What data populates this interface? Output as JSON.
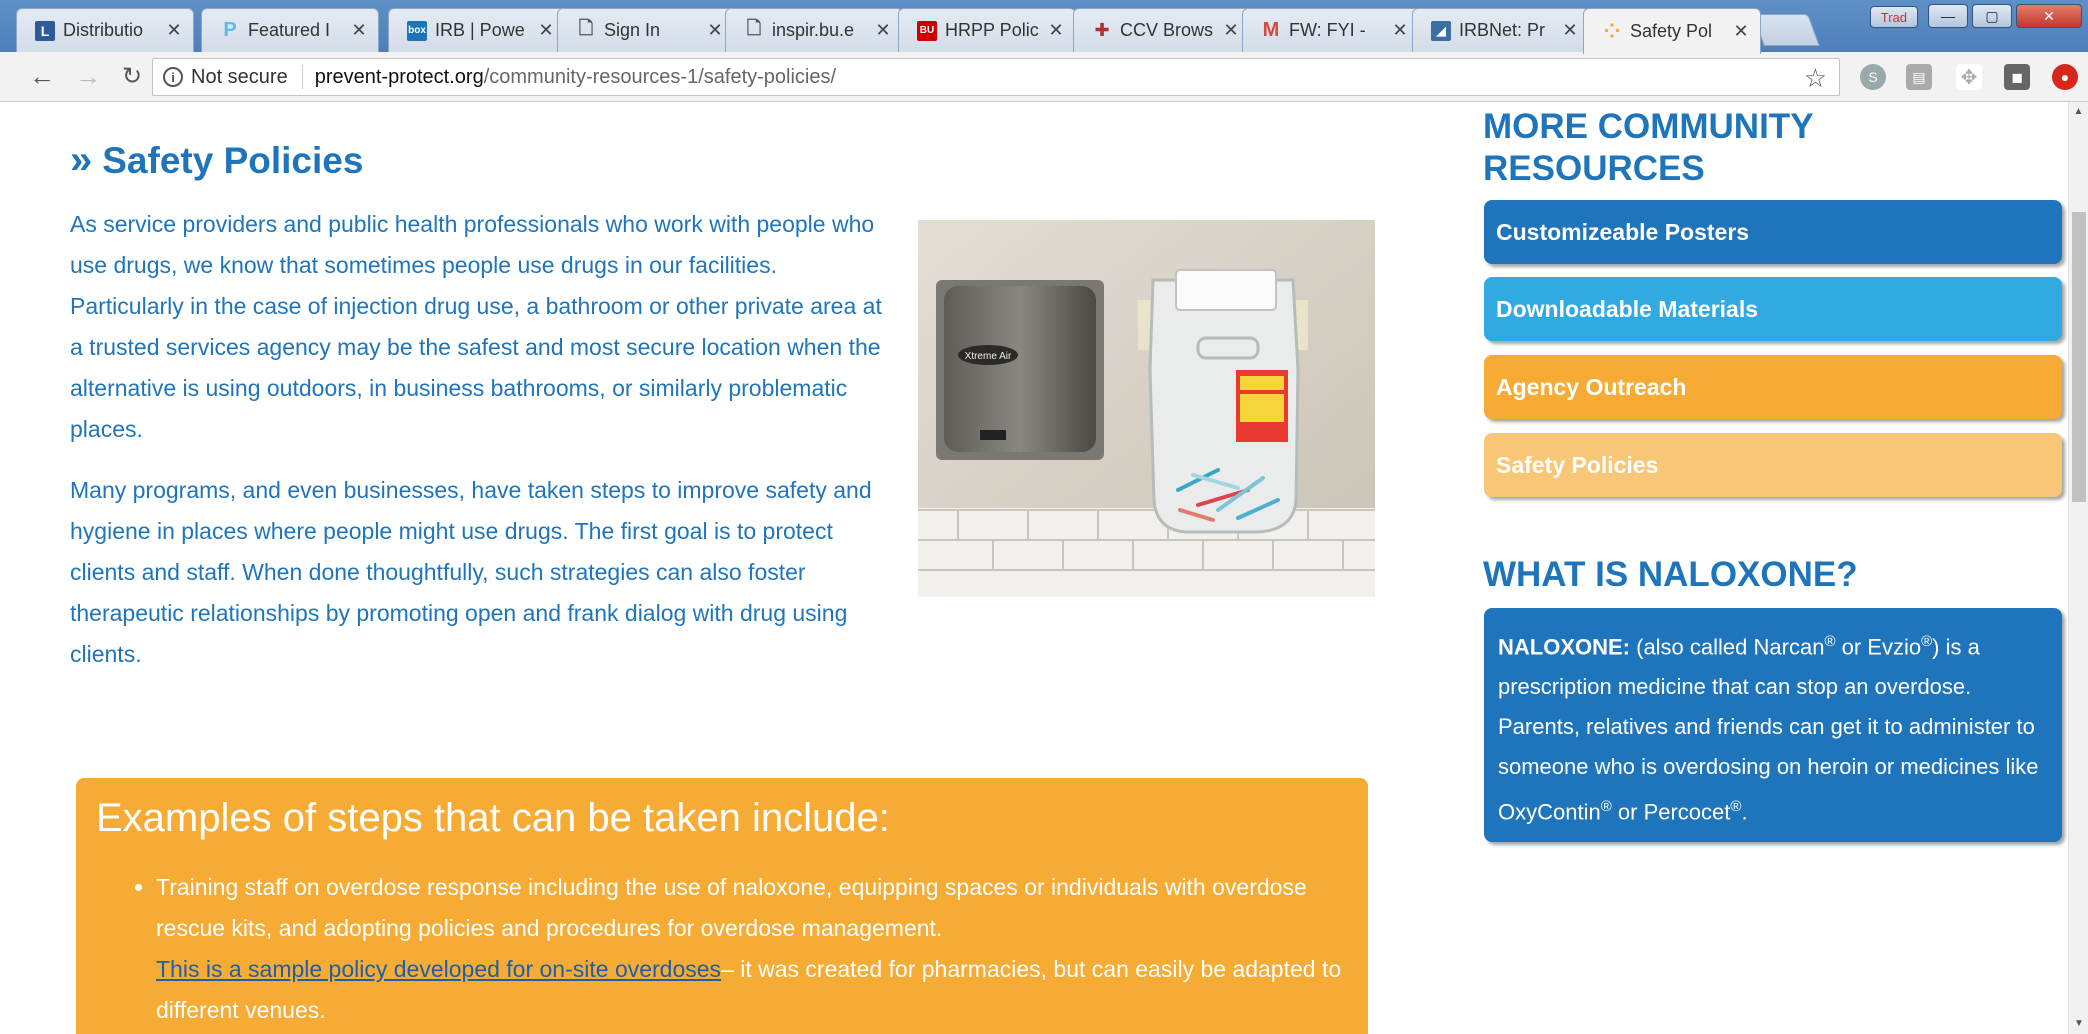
{
  "browser": {
    "tabs": [
      {
        "label": "Distributio",
        "favicon": "L",
        "favicon_color": "#2d5c99"
      },
      {
        "label": "Featured I",
        "favicon": "P",
        "favicon_color": "#5bbbe6"
      },
      {
        "label": "IRB | Powe",
        "favicon": "box",
        "favicon_color": "#1c75bc"
      },
      {
        "label": "Sign In",
        "favicon": "page-icon",
        "favicon_color": "#ffffff"
      },
      {
        "label": "inspir.bu.e",
        "favicon": "page-icon",
        "favicon_color": "#ffffff"
      },
      {
        "label": "HRPP Polic",
        "favicon": "BU",
        "favicon_color": "#cc0000"
      },
      {
        "label": "CCV Brows",
        "favicon": "+",
        "favicon_color": "#b03030"
      },
      {
        "label": "FW: FYI - ",
        "favicon": "M",
        "favicon_color": "#d64a3b"
      },
      {
        "label": "IRBNet: Pr",
        "favicon": "chart-icon",
        "favicon_color": "#3a6ea5"
      },
      {
        "label": "Safety Pol",
        "favicon": "dots-icon",
        "favicon_color": "#f6ab35"
      }
    ],
    "user_chip": "Trad",
    "security_label": "Not secure",
    "url_host": "prevent-protect.org",
    "url_path": "/community-resources-1/safety-policies/"
  },
  "page": {
    "title_marker": "»",
    "title": "Safety Policies",
    "para1": "As service providers and public health professionals who work with people who use drugs, we know that sometimes people use drugs in our facilities. Particularly in the case of injection drug use, a bathroom or other private area at a trusted services agency may be the safest and most secure location when the alternative is using outdoors, in business bathrooms, or similarly problematic places.",
    "para2": "Many programs, and even businesses, have taken steps to improve safety and hygiene in places where people might use drugs. The first goal is to protect clients and staff. When done thoughtfully, such strategies can also foster therapeutic relationships by promoting open and frank dialog with drug using clients.",
    "dryer_label": "Xtreme Air",
    "examples": {
      "heading": "Examples of steps that can be taken include:",
      "item1": "Training staff on overdose response including the use of naloxone, equipping spaces or individuals with overdose rescue kits, and adopting policies and procedures for overdose management.",
      "item1_link": "This is a sample policy developed for on-site overdoses",
      "item1_tail": "– it was created for pharmacies, but can easily be adapted to different venues."
    }
  },
  "sidebar": {
    "resources_heading": "MORE COMMUNITY RESOURCES",
    "buttons": [
      {
        "label": "Customizeable Posters",
        "color": "#1f75bb"
      },
      {
        "label": "Downloadable Materials",
        "color": "#31a9e1"
      },
      {
        "label": "Agency Outreach",
        "color": "#f6ab35"
      },
      {
        "label": "Safety Policies",
        "color": "#f8c677"
      }
    ],
    "naloxone_heading": "WHAT IS NALOXONE?",
    "naloxone": {
      "term": "NALOXONE:",
      "t1": " (also called Narcan",
      "r": "®",
      "t2": " or Evzio",
      "t3": ") is a prescription medicine that can stop an overdose. Parents, relatives and friends can get it to administer to someone who is overdosing on heroin or medicines like OxyContin",
      "t4": " or Percocet",
      "t5": "."
    }
  }
}
